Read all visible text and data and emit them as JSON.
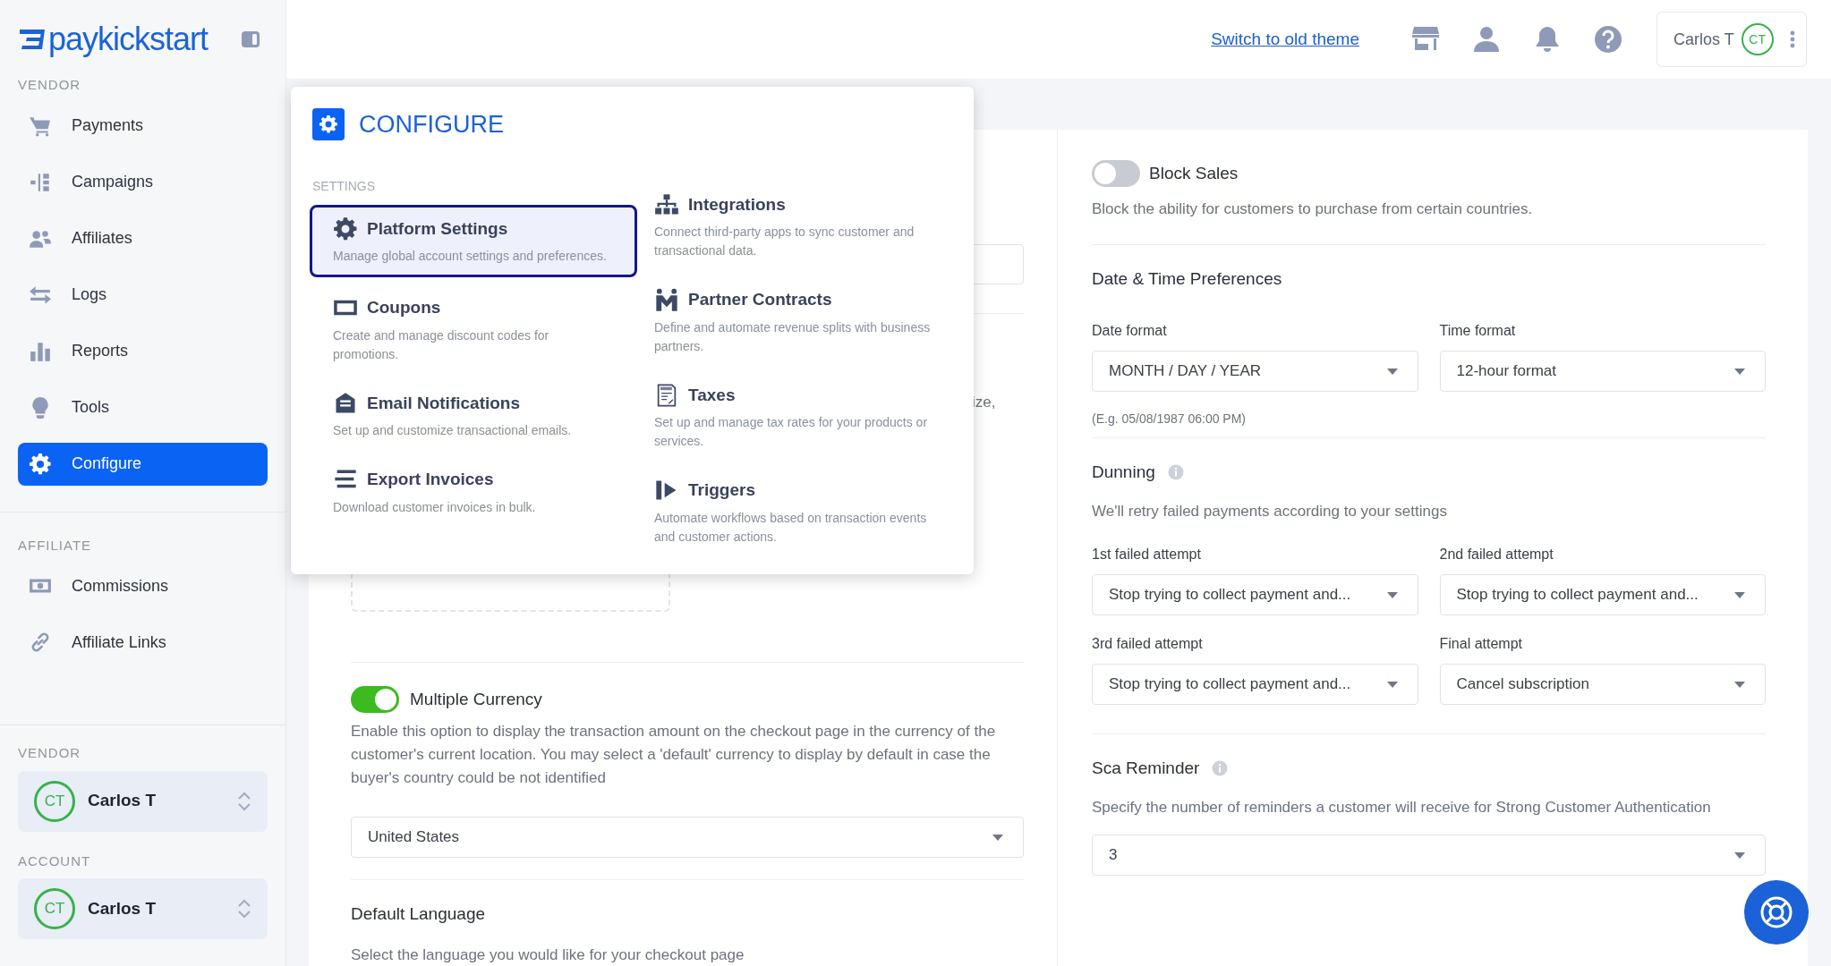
{
  "sidebar": {
    "logo": "paykickstart",
    "sections": [
      {
        "heading": "VENDOR",
        "items": [
          {
            "label": "Payments",
            "selected": false
          },
          {
            "label": "Campaigns",
            "selected": false
          },
          {
            "label": "Affiliates",
            "selected": false
          },
          {
            "label": "Logs",
            "selected": false
          },
          {
            "label": "Reports",
            "selected": false
          },
          {
            "label": "Tools",
            "selected": false
          },
          {
            "label": "Configure",
            "selected": true
          }
        ]
      },
      {
        "heading": "AFFILIATE",
        "items": [
          {
            "label": "Commissions",
            "selected": false
          },
          {
            "label": "Affiliate Links",
            "selected": false
          }
        ]
      }
    ],
    "switchers": [
      {
        "heading": "VENDOR",
        "initials": "CT",
        "name": "Carlos T"
      },
      {
        "heading": "ACCOUNT",
        "initials": "CT",
        "name": "Carlos T"
      }
    ]
  },
  "header": {
    "link": "Switch to old theme",
    "user": {
      "name": "Carlos T",
      "initials": "CT"
    }
  },
  "configure_menu": {
    "title": "CONFIGURE",
    "section": "SETTINGS",
    "columns": [
      {
        "items": [
          {
            "title": "Platform Settings",
            "description": "Manage global account settings and preferences.",
            "selected": true
          },
          {
            "title": "Coupons",
            "description": "Create and manage discount codes for promotions.",
            "selected": false
          },
          {
            "title": "Email Notifications",
            "description": "Set up and customize transactional emails.",
            "selected": false
          },
          {
            "title": "Export Invoices",
            "description": "Download customer invoices in bulk.",
            "selected": false
          }
        ]
      },
      {
        "items": [
          {
            "title": "Integrations",
            "description": "Connect third-party apps to sync customer and transactional data.",
            "selected": false
          },
          {
            "title": "Partner Contracts",
            "description": "Define and automate revenue splits with business partners.",
            "selected": false
          },
          {
            "title": "Taxes",
            "description": "Set up and manage tax rates for your products or services.",
            "selected": false
          },
          {
            "title": "Triggers",
            "description": "Automate workflows based on transaction events and customer actions.",
            "selected": false
          }
        ]
      }
    ]
  },
  "left_column": {
    "hidden_fragment": "ize,",
    "multiple_currency": {
      "label": "Multiple Currency",
      "on": true,
      "description": "Enable this option to display the transaction amount on the checkout page in the currency of the customer's current location. You may select a 'default' currency to display by default in case the buyer's country could be not identified",
      "value": "United States"
    },
    "default_language": {
      "title": "Default Language",
      "description": "Select the language you would like for your checkout page"
    }
  },
  "right_column": {
    "block_sales": {
      "label": "Block Sales",
      "on": false,
      "description": "Block the ability for customers to purchase from certain countries."
    },
    "date_time": {
      "title": "Date & Time Preferences",
      "fields": [
        {
          "label": "Date format",
          "value": "MONTH / DAY / YEAR"
        },
        {
          "label": "Time format",
          "value": "12-hour format"
        }
      ],
      "example": "(E.g. 05/08/1987 06:00 PM)"
    },
    "dunning": {
      "title": "Dunning",
      "description": "We'll retry failed payments according to your settings",
      "fields": [
        {
          "label": "1st failed attempt",
          "value": "Stop trying to collect payment and..."
        },
        {
          "label": "2nd failed attempt",
          "value": "Stop trying to collect payment and..."
        },
        {
          "label": "3rd failed attempt",
          "value": "Stop trying to collect payment and..."
        },
        {
          "label": "Final attempt",
          "value": "Cancel subscription"
        }
      ]
    },
    "sca_reminder": {
      "title": "Sca Reminder",
      "description": "Specify the number of reminders a customer will receive for Strong Customer Authentication",
      "value": "3"
    }
  }
}
